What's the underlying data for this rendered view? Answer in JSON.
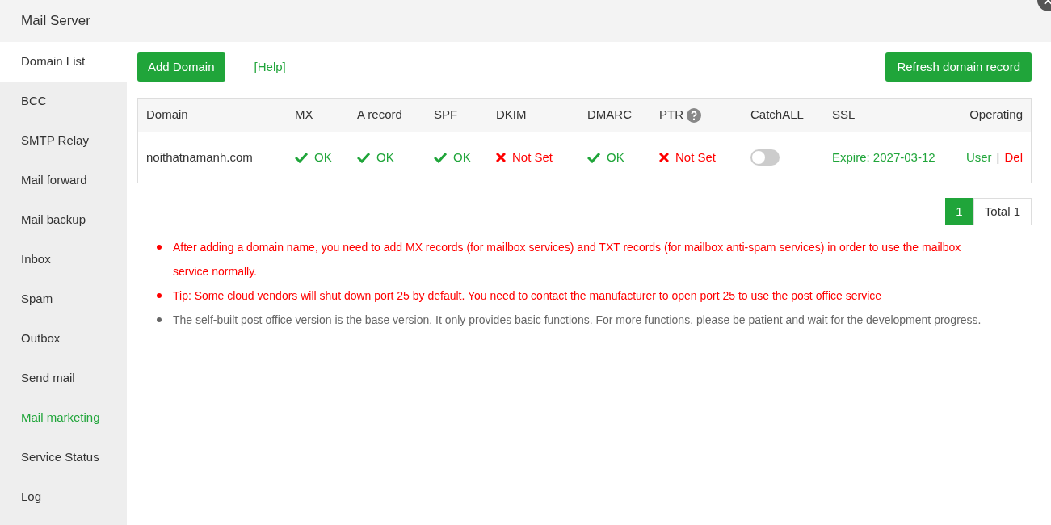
{
  "window": {
    "title": "Mail Server"
  },
  "sidebar": {
    "items": [
      {
        "label": "Domain List",
        "selected": true,
        "highlight": false
      },
      {
        "label": "BCC",
        "selected": false,
        "highlight": false
      },
      {
        "label": "SMTP Relay",
        "selected": false,
        "highlight": false
      },
      {
        "label": "Mail forward",
        "selected": false,
        "highlight": false
      },
      {
        "label": "Mail backup",
        "selected": false,
        "highlight": false
      },
      {
        "label": "Inbox",
        "selected": false,
        "highlight": false
      },
      {
        "label": "Spam",
        "selected": false,
        "highlight": false
      },
      {
        "label": "Outbox",
        "selected": false,
        "highlight": false
      },
      {
        "label": "Send mail",
        "selected": false,
        "highlight": false
      },
      {
        "label": "Mail marketing",
        "selected": false,
        "highlight": true
      },
      {
        "label": "Service Status",
        "selected": false,
        "highlight": false
      },
      {
        "label": "Log",
        "selected": false,
        "highlight": false
      }
    ]
  },
  "toolbar": {
    "add_button": "Add Domain",
    "help_link": "[Help]",
    "refresh_button": "Refresh domain record"
  },
  "table": {
    "columns": [
      "Domain",
      "MX",
      "A record",
      "SPF",
      "DKIM",
      "DMARC",
      "PTR",
      "CatchALL",
      "SSL",
      "Operating"
    ],
    "rows": [
      {
        "domain": "noithatnamanh.com",
        "statuses": [
          {
            "kind": "ok",
            "text": "OK"
          },
          {
            "kind": "ok",
            "text": "OK"
          },
          {
            "kind": "ok",
            "text": "OK"
          },
          {
            "kind": "notset",
            "text": "Not Set"
          },
          {
            "kind": "ok",
            "text": "OK"
          },
          {
            "kind": "notset",
            "text": "Not Set"
          }
        ],
        "catchall": {
          "on": false
        },
        "ssl": "Expire: 2027-03-12",
        "user_link": "User",
        "separator": "|",
        "del_link": "Del"
      }
    ]
  },
  "pagination": {
    "pages": [
      {
        "label": "1",
        "selected": true
      }
    ],
    "total": "Total 1"
  },
  "notes": [
    {
      "text": "After adding a domain name, you need to add MX records (for mailbox services) and TXT records (for mailbox anti-spam services) in order to use the mailbox service normally.",
      "color": "#ff0000"
    },
    {
      "text": "Tip: Some cloud vendors will shut down port 25 by default. You need to contact the manufacturer to open port 25 to use the post office service",
      "color": "#ff0000"
    },
    {
      "text": "The self-built post office version is the base version. It only provides basic functions. For more functions, please be patient and wait for the development progress.",
      "color": "#666666"
    }
  ]
}
